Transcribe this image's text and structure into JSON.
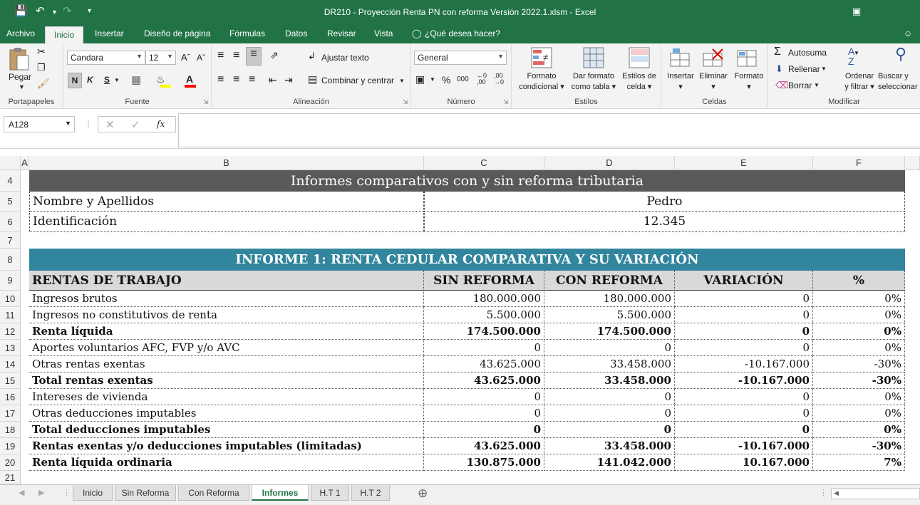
{
  "window": {
    "title": "DR210 - Proyección Renta PN con reforma Versión 2022.1.xlsm - Excel"
  },
  "menu": {
    "tabs": [
      "Archivo",
      "Inicio",
      "Insertar",
      "Diseño de página",
      "Fórmulas",
      "Datos",
      "Revisar",
      "Vista"
    ],
    "tell_me": "¿Qué desea hacer?"
  },
  "ribbon": {
    "clipboard": {
      "paste": "Pegar",
      "group": "Portapapeles"
    },
    "font": {
      "name": "Candara",
      "size": "12",
      "bold": "N",
      "italic": "K",
      "underline": "S",
      "group": "Fuente"
    },
    "alignment": {
      "wrap": "Ajustar texto",
      "merge": "Combinar y centrar",
      "group": "Alineación"
    },
    "number": {
      "format": "General",
      "percent": "%",
      "thousands": "000",
      "group": "Número"
    },
    "styles": {
      "conditional": [
        "Formato",
        "condicional"
      ],
      "as_table": [
        "Dar formato",
        "como tabla"
      ],
      "cell_styles": [
        "Estilos de",
        "celda"
      ],
      "group": "Estilos"
    },
    "cells": {
      "insert": "Insertar",
      "delete": "Eliminar",
      "format": "Formato",
      "group": "Celdas"
    },
    "editing": {
      "autosum": "Autosuma",
      "fill": "Rellenar",
      "clear": "Borrar",
      "sort": [
        "Ordenar",
        "y filtrar"
      ],
      "find": [
        "Buscar y",
        "seleccionar"
      ],
      "group": "Modificar"
    }
  },
  "formula_bar": {
    "name_box": "A128",
    "fx": "fx",
    "value": ""
  },
  "columns": [
    "A",
    "B",
    "C",
    "D",
    "E",
    "F"
  ],
  "rows": [
    "4",
    "5",
    "6",
    "7",
    "8",
    "9",
    "10",
    "11",
    "12",
    "13",
    "14",
    "15",
    "16",
    "17",
    "18",
    "19",
    "20",
    "21"
  ],
  "sheet": {
    "title": "Informes comparativos con y sin reforma tributaria",
    "name_label": "Nombre y Apellidos",
    "name_value": "Pedro",
    "id_label": "Identificación",
    "id_value": "12.345",
    "report_title": "INFORME 1: RENTA CEDULAR COMPARATIVA Y SU VARIACIÓN",
    "header": [
      "RENTAS DE TRABAJO",
      "SIN REFORMA",
      "CON REFORMA",
      "VARIACIÓN",
      "%"
    ],
    "table": [
      [
        "Ingresos brutos",
        "180.000.000",
        "180.000.000",
        "0",
        "0%"
      ],
      [
        "Ingresos no constitutivos de renta",
        "5.500.000",
        "5.500.000",
        "0",
        "0%"
      ],
      [
        "Renta líquida",
        "174.500.000",
        "174.500.000",
        "0",
        "0%"
      ],
      [
        "Aportes voluntarios AFC, FVP y/o AVC",
        "0",
        "0",
        "0",
        "0%"
      ],
      [
        "Otras rentas exentas",
        "43.625.000",
        "33.458.000",
        "-10.167.000",
        "-30%"
      ],
      [
        "Total rentas exentas",
        "43.625.000",
        "33.458.000",
        "-10.167.000",
        "-30%"
      ],
      [
        "Intereses de vivienda",
        "0",
        "0",
        "0",
        "0%"
      ],
      [
        "Otras deducciones imputables",
        "0",
        "0",
        "0",
        "0%"
      ],
      [
        "Total deducciones imputables",
        "0",
        "0",
        "0",
        "0%"
      ],
      [
        "Rentas exentas y/o deducciones imputables (limitadas)",
        "43.625.000",
        "33.458.000",
        "-10.167.000",
        "-30%"
      ],
      [
        "Renta líquida ordinaria",
        "130.875.000",
        "141.042.000",
        "10.167.000",
        "7%"
      ]
    ],
    "bold_rows": [
      2,
      5,
      8,
      9,
      10
    ]
  },
  "sheet_tabs": [
    "Inicio",
    "Sin Reforma",
    "Con Reforma",
    "Informes",
    "H.T 1",
    "H.T 2"
  ],
  "active_sheet": "Informes",
  "colors": {
    "excel_green": "#217346",
    "title_fill": "#595959",
    "report_fill": "#31859c",
    "header_fill": "#d9d9d9"
  }
}
